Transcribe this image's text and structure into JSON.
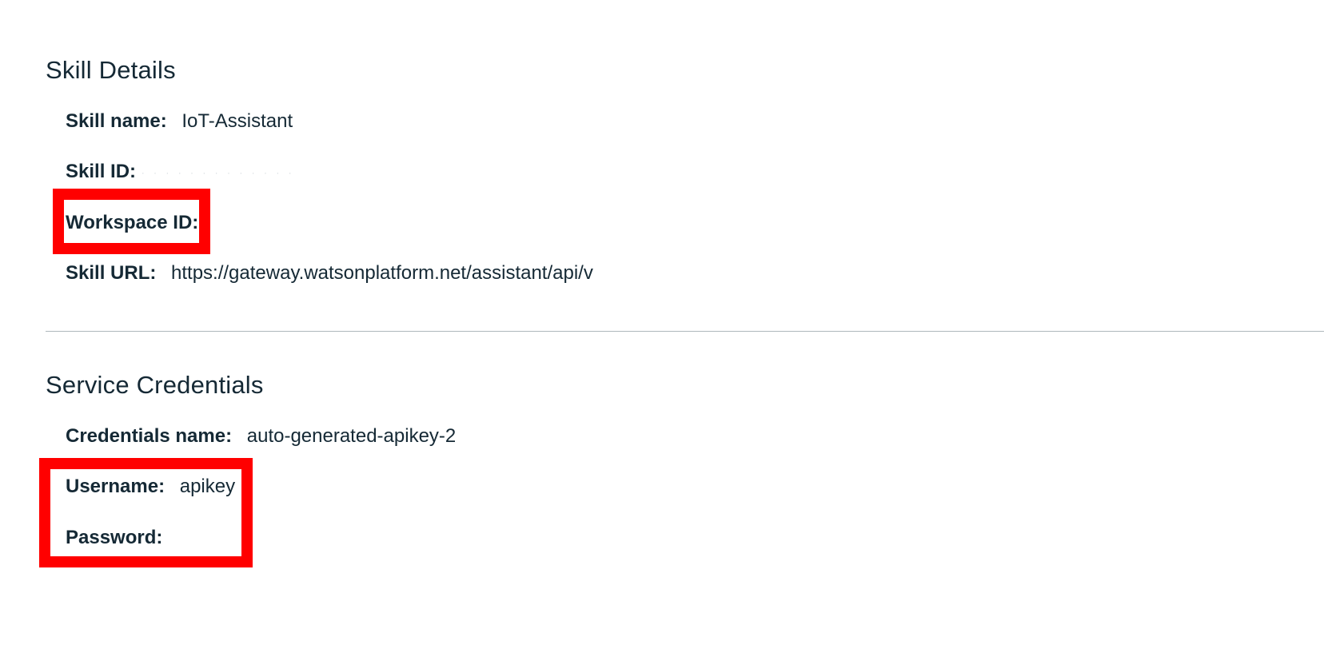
{
  "skill_details": {
    "title": "Skill Details",
    "skill_name_label": "Skill name:",
    "skill_name_value": "IoT-Assistant",
    "skill_id_label": "Skill ID:",
    "workspace_id_label": "Workspace ID:",
    "skill_url_label": "Skill URL:",
    "skill_url_value": "https://gateway.watsonplatform.net/assistant/api/v"
  },
  "service_credentials": {
    "title": "Service Credentials",
    "credentials_name_label": "Credentials name:",
    "credentials_name_value": "auto-generated-apikey-2",
    "username_label": "Username:",
    "username_value": "apikey",
    "password_label": "Password:"
  },
  "colors": {
    "highlight": "#ff0000",
    "text": "#152935",
    "divider": "#aeb7bc"
  }
}
